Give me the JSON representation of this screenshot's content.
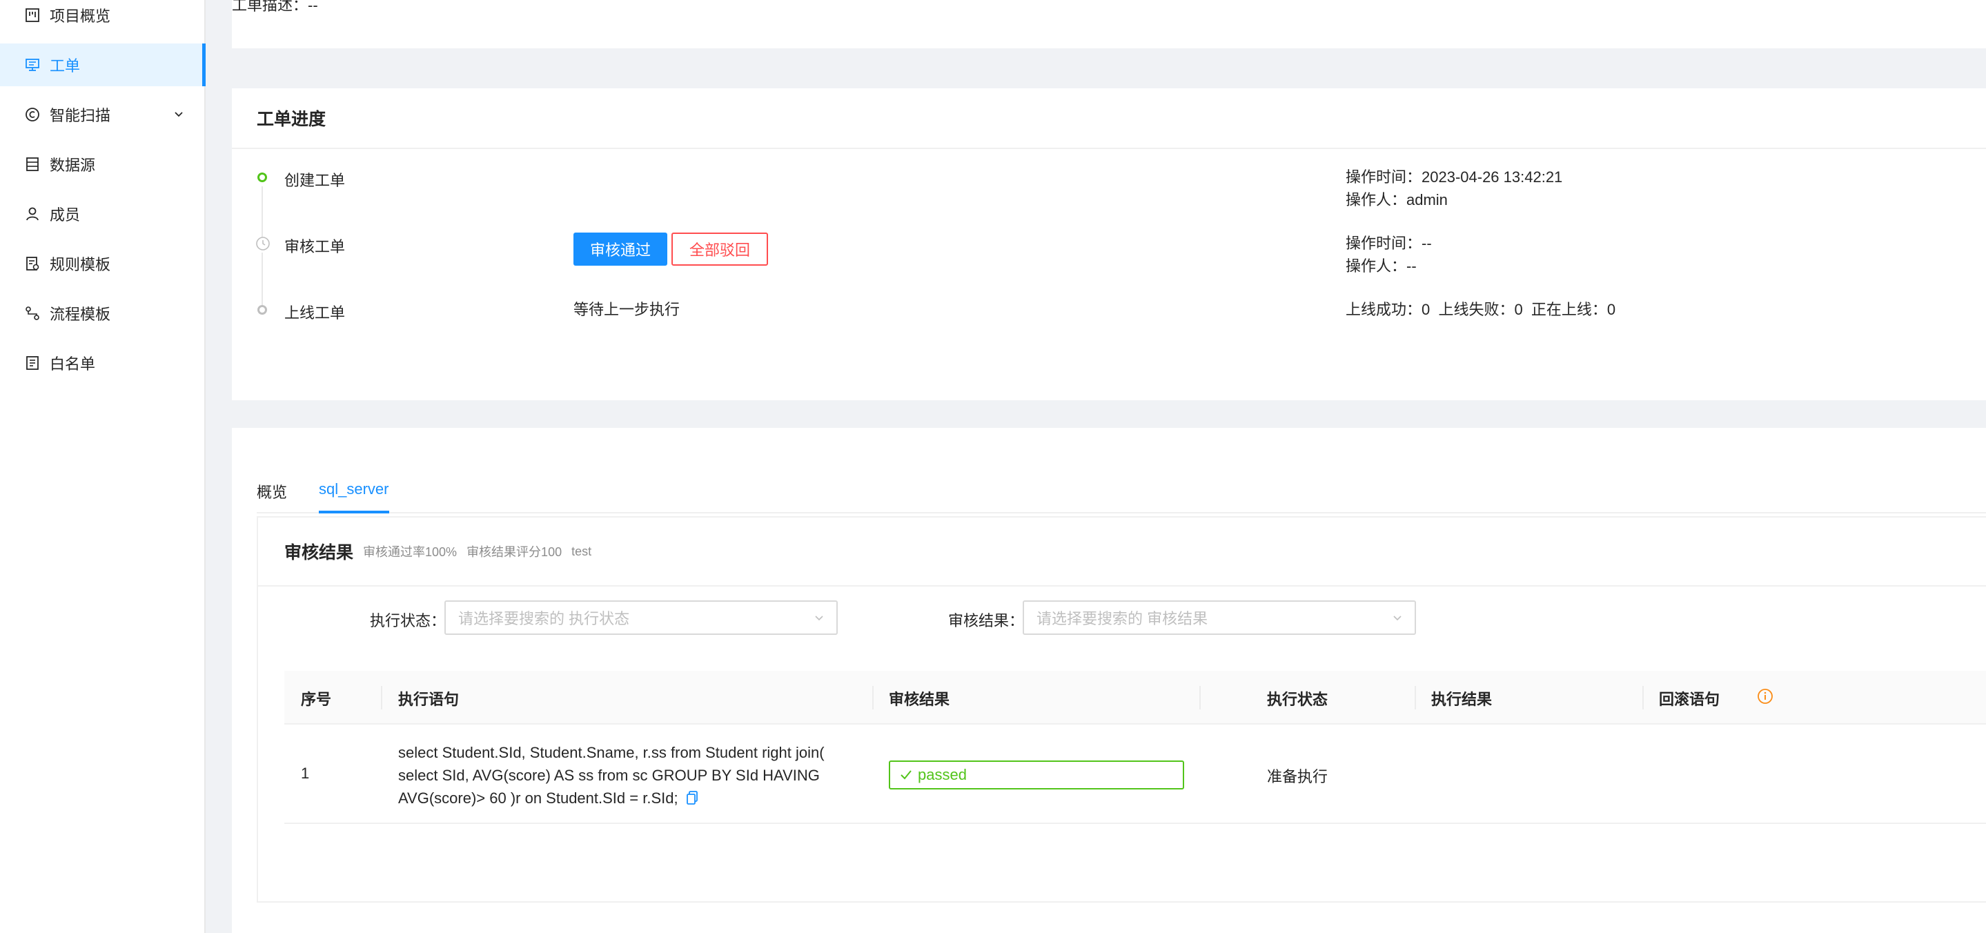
{
  "sidebar": {
    "items": [
      {
        "label": "项目概览",
        "icon": "project-overview-icon"
      },
      {
        "label": "工单",
        "icon": "ticket-icon",
        "active": true
      },
      {
        "label": "智能扫描",
        "icon": "smart-scan-icon",
        "has_submenu": true
      },
      {
        "label": "数据源",
        "icon": "datasource-icon"
      },
      {
        "label": "成员",
        "icon": "member-icon"
      },
      {
        "label": "规则模板",
        "icon": "rule-template-icon"
      },
      {
        "label": "流程模板",
        "icon": "workflow-template-icon"
      },
      {
        "label": "白名单",
        "icon": "whitelist-icon"
      }
    ]
  },
  "header": {
    "description": "工单描述：--"
  },
  "progress": {
    "title": "工单进度",
    "steps": [
      {
        "label": "创建工单",
        "status_color": "#52c41a",
        "op_time": "操作时间：2023-04-26 13:42:21",
        "operator": "操作人：admin"
      },
      {
        "label": "审核工单",
        "approve_label": "审核通过",
        "reject_label": "全部驳回",
        "op_time": "操作时间：--",
        "operator": "操作人：--"
      },
      {
        "label": "上线工单",
        "status_text": "等待上一步执行",
        "stats": "上线成功：0  上线失败：0  正在上线：0"
      }
    ]
  },
  "detail": {
    "tabs": [
      {
        "label": "概览"
      },
      {
        "label": "sql_server",
        "active": true
      }
    ],
    "result": {
      "title": "审核结果",
      "pass_rate": "审核通过率100%",
      "score": "审核结果评分100",
      "name": "test"
    },
    "filters": {
      "exec_status_label": "执行状态：",
      "exec_status_placeholder": "请选择要搜索的 执行状态",
      "audit_result_label": "审核结果：",
      "audit_result_placeholder": "请选择要搜索的 审核结果"
    },
    "table": {
      "columns": [
        "序号",
        "执行语句",
        "审核结果",
        "执行状态",
        "执行结果",
        "回滚语句"
      ],
      "rows": [
        {
          "index": "1",
          "sql": "select Student.SId, Student.Sname, r.ss from Student right join( select SId, AVG(score) AS ss from sc GROUP BY SId HAVING AVG(score)> 60 )r on Student.SId = r.SId;",
          "audit": "passed",
          "exec_status": "准备执行",
          "exec_result": ""
        }
      ]
    }
  },
  "colors": {
    "primary": "#1890ff",
    "success": "#52c41a",
    "danger": "#ff4d4f",
    "warning": "#fa8c16"
  }
}
